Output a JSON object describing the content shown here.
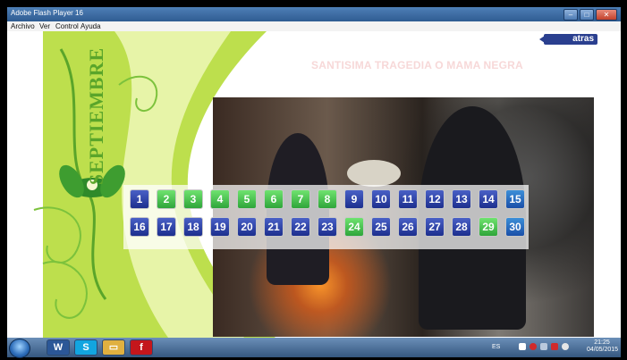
{
  "window": {
    "title": "Adobe Flash Player 16",
    "controls": {
      "minimize": "–",
      "maximize": "□",
      "close": "✕"
    }
  },
  "menu": [
    "Archivo",
    "Ver",
    "Control",
    "Ayuda"
  ],
  "atras_label": "atras",
  "heading": "SANTISIMA TRAGEDIA O MAMA NEGRA",
  "month": "SEPTIEMBRE",
  "calendar": {
    "row1": [
      {
        "day": "1",
        "style": "blue"
      },
      {
        "day": "2",
        "style": "green"
      },
      {
        "day": "3",
        "style": "green"
      },
      {
        "day": "4",
        "style": "green"
      },
      {
        "day": "5",
        "style": "green"
      },
      {
        "day": "6",
        "style": "green"
      },
      {
        "day": "7",
        "style": "green"
      },
      {
        "day": "8",
        "style": "green"
      },
      {
        "day": "9",
        "style": "blue"
      },
      {
        "day": "10",
        "style": "blue"
      },
      {
        "day": "11",
        "style": "blue"
      },
      {
        "day": "12",
        "style": "blue"
      },
      {
        "day": "13",
        "style": "blue"
      },
      {
        "day": "14",
        "style": "blue"
      },
      {
        "day": "15",
        "style": "teal"
      }
    ],
    "row2": [
      {
        "day": "16",
        "style": "blue"
      },
      {
        "day": "17",
        "style": "blue"
      },
      {
        "day": "18",
        "style": "blue"
      },
      {
        "day": "19",
        "style": "blue"
      },
      {
        "day": "20",
        "style": "blue"
      },
      {
        "day": "21",
        "style": "blue"
      },
      {
        "day": "22",
        "style": "blue"
      },
      {
        "day": "23",
        "style": "blue"
      },
      {
        "day": "24",
        "style": "green"
      },
      {
        "day": "25",
        "style": "blue"
      },
      {
        "day": "26",
        "style": "blue"
      },
      {
        "day": "27",
        "style": "blue"
      },
      {
        "day": "28",
        "style": "blue"
      },
      {
        "day": "29",
        "style": "green"
      },
      {
        "day": "30",
        "style": "teal"
      }
    ]
  },
  "taskbar": {
    "apps": [
      {
        "name": "word-icon",
        "glyph": "W",
        "color": "#2b5797"
      },
      {
        "name": "skype-icon",
        "glyph": "S",
        "color": "#12a5e0"
      },
      {
        "name": "folder-icon",
        "glyph": "▭",
        "color": "#e0b040"
      },
      {
        "name": "flash-icon",
        "glyph": "f",
        "color": "#c4161c"
      }
    ],
    "lang": "ES",
    "time": "21:25",
    "date": "04/05/2015"
  },
  "colors": {
    "accent_blue": "#2a3f8f",
    "day_green": "#3fbf4a",
    "lime": "#b6dc3a"
  }
}
